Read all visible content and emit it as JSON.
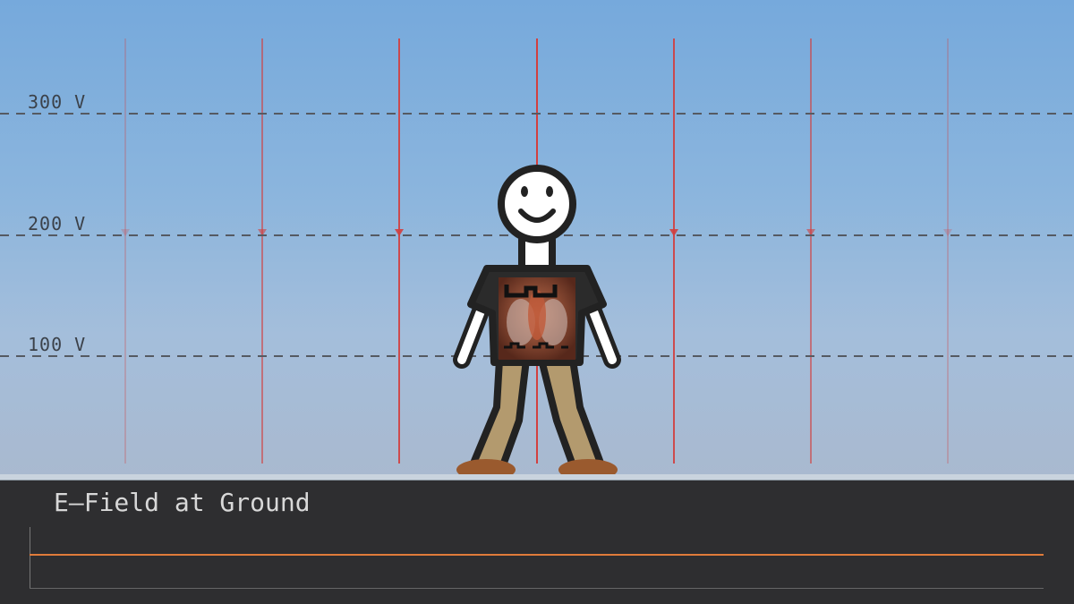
{
  "scene": {
    "equipotential_labels": [
      "300 V",
      "200 V",
      "100 V"
    ],
    "equipotential_values": [
      300,
      200,
      100
    ],
    "field_line_color": "#d23f3f",
    "equipotential_color": "#555a62",
    "sky_color_top": "#76a9dc",
    "sky_color_bottom": "#a9b9cf"
  },
  "figure": {
    "icons": [
      "smiley-face-icon",
      "band-shirt-graphic"
    ],
    "shirt_color": "#2b2b2b",
    "pants_color": "#b39a6e",
    "shoe_color": "#9a5a2e"
  },
  "panel": {
    "title": "E–Field at Ground",
    "trace_color": "#e07b3a",
    "background": "#2e2e30"
  }
}
